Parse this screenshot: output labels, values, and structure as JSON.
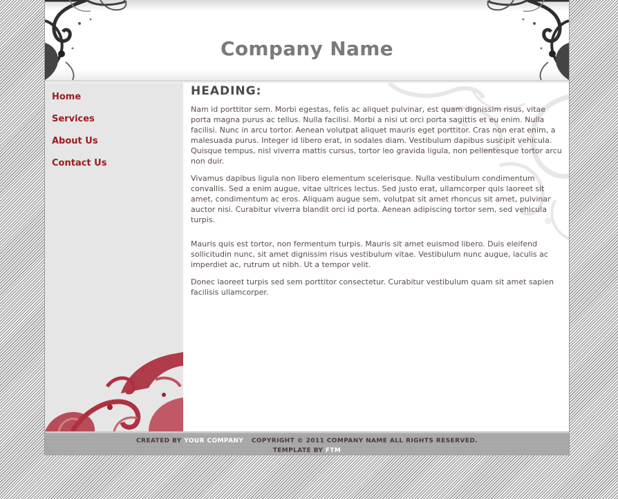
{
  "header": {
    "company_name": "Company Name"
  },
  "nav": {
    "items": [
      {
        "label": "Home"
      },
      {
        "label": "Services"
      },
      {
        "label": "About Us"
      },
      {
        "label": "Contact Us"
      }
    ]
  },
  "content": {
    "heading": "HEADING:",
    "paragraphs": [
      "Nam id porttitor sem. Morbi egestas, felis ac aliquet pulvinar, est quam dignissim risus, vitae porta magna purus ac tellus. Nulla facilisi. Morbi a nisi ut orci porta sagittis et eu enim. Nulla facilisi. Nunc in arcu tortor. Aenean volutpat aliquet mauris eget porttitor. Cras non erat enim, a malesuada purus. Integer id libero erat, in sodales diam. Vestibulum dapibus suscipit vehicula. Quisque tempus, nisl viverra mattis cursus, tortor leo gravida ligula, non pellentesque tortor arcu non duir.",
      "Vivamus dapibus ligula non libero elementum scelerisque. Nulla vestibulum condimentum convallis. Sed a enim augue, vitae ultrices lectus. Sed justo erat, ullamcorper quis laoreet sit amet, condimentum ac eros. Aliquam augue sem, volutpat sit amet rhoncus sit amet, pulvinar auctor nisi. Curabitur viverra blandit orci id porta. Aenean adipiscing tortor sem, sed vehicula turpis.",
      "Mauris quis est tortor, non fermentum turpis. Mauris sit amet euismod libero. Duis eleifend sollicitudin nunc, sit amet dignissim risus vestibulum vitae. Vestibulum nunc augue, iaculis ac imperdiet ac, rutrum ut nibh. Ut a tempor velit.",
      "Donec laoreet turpis sed sem porttitor consectetur. Curabitur vestibulum quam sit amet sapien facilisis ullamcorper."
    ]
  },
  "footer": {
    "created_by_prefix": "CREATED BY",
    "created_by_link": "YOUR COMPANY",
    "copyright": "COPYRIGHT © 2011 COMPANY NAME ALL RIGHTS RESERVED.",
    "template_by_prefix": "TEMPLATE BY",
    "template_by_link": "FTM"
  },
  "colors": {
    "nav_link": "#9b1a1f",
    "ornament_red": "#b03040",
    "ornament_dark": "#3a3a3a"
  },
  "icons": {
    "header_ornament": "swirl-ornament-icon",
    "sidebar_ornament": "floral-swirl-icon"
  }
}
